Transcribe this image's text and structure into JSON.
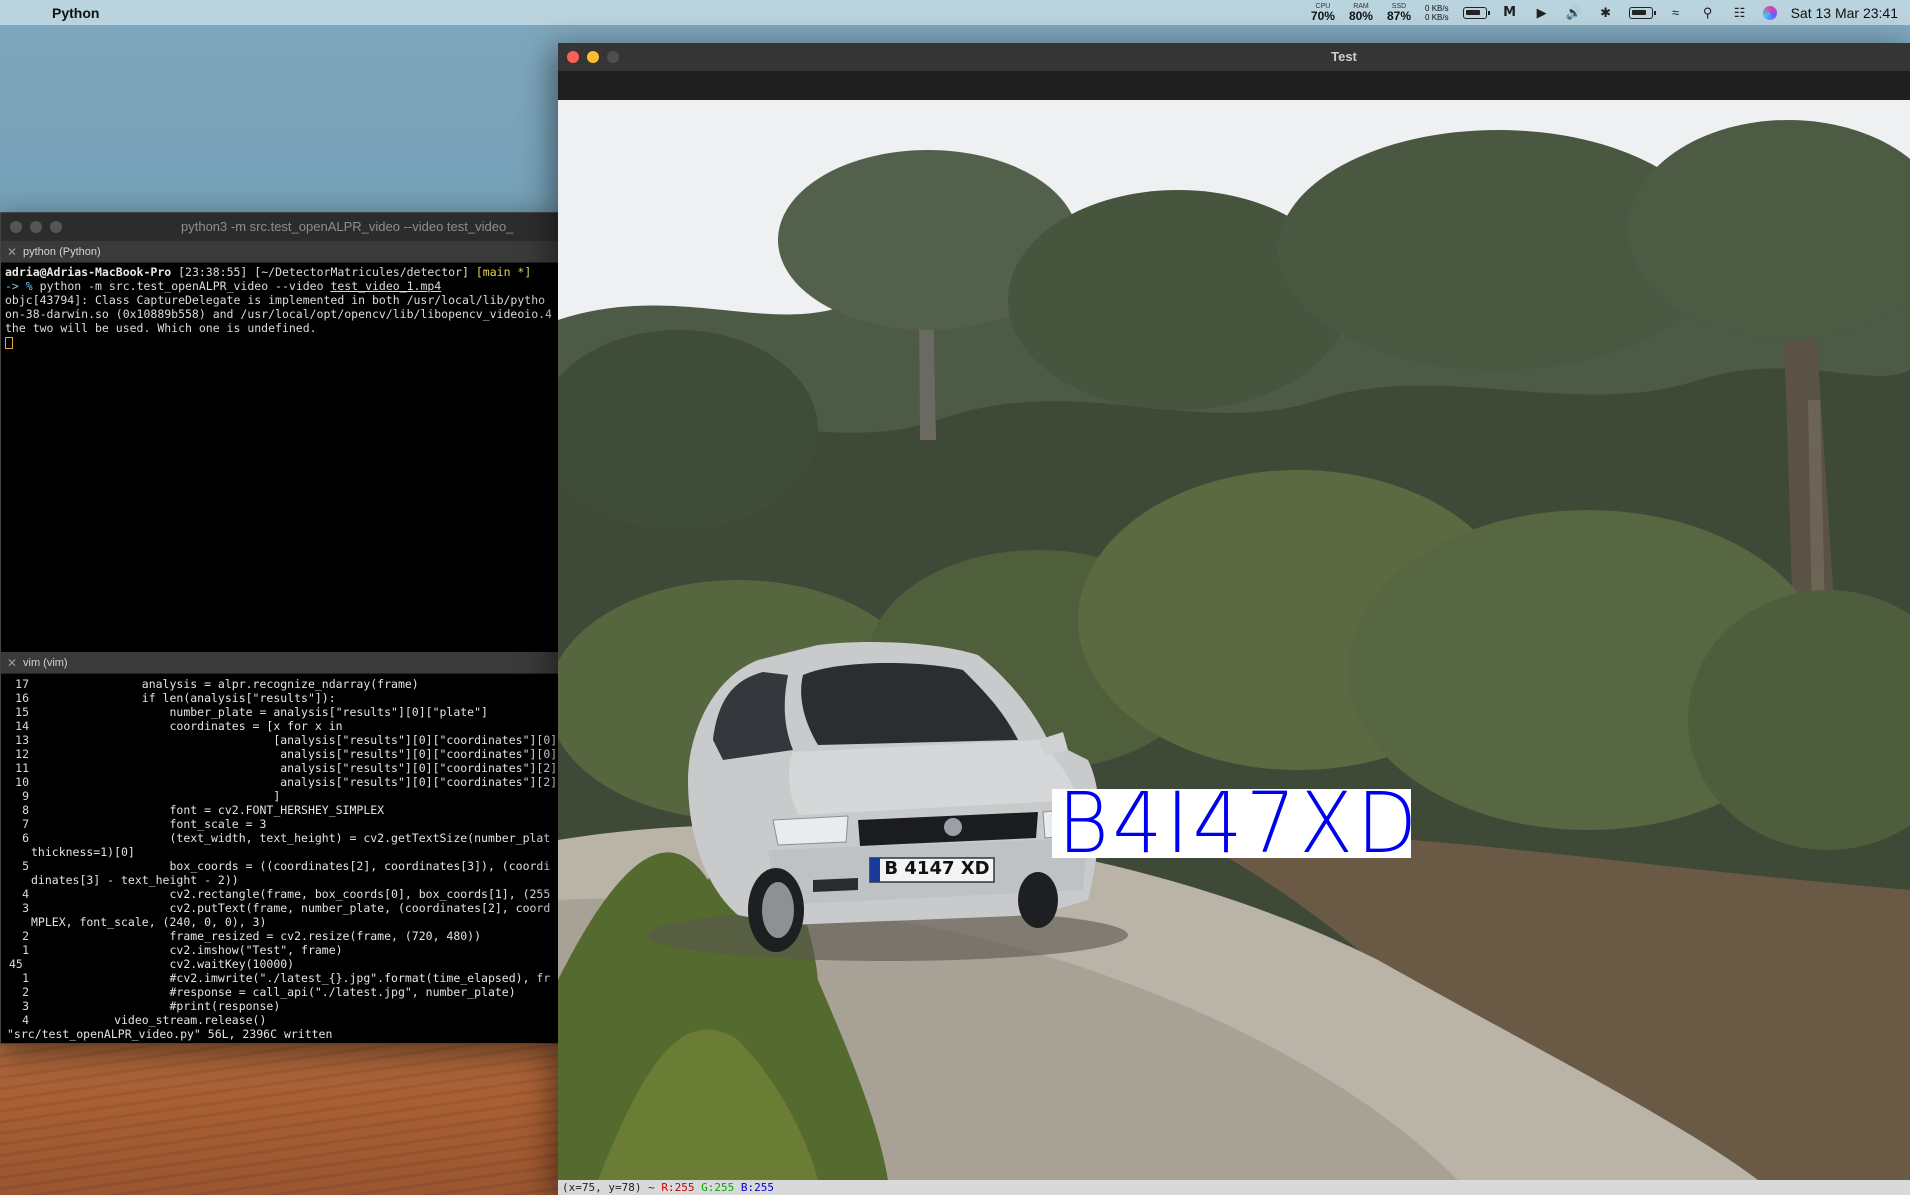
{
  "menubar": {
    "app_name": "Python",
    "cpu_label": "CPU",
    "cpu_value": "70%",
    "ram_label": "RAM",
    "ram_value": "80%",
    "ssd_label": "SSD",
    "ssd_value": "87%",
    "net_up": "0 KB/s",
    "net_down": "0 KB/s",
    "clock": "Sat 13 Mar  23:41"
  },
  "terminal": {
    "title": "python3 -m src.test_openALPR_video --video test_video_",
    "pane1_tab": "python (Python)",
    "prompt_user": "adria@Adrias-MacBook-Pro",
    "prompt_time": "[23:38:55]",
    "prompt_dir": "[~/DetectorMatricules/detector]",
    "prompt_branch": "[main *]",
    "prompt_arrow": "-> %",
    "command": "python -m src.test_openALPR_video --video",
    "command_arg": "test_video_1.mp4",
    "output": [
      "objc[43794]: Class CaptureDelegate is implemented in both /usr/local/lib/pytho",
      "on-38-darwin.so (0x10889b558) and /usr/local/opt/opencv/lib/libopencv_videoio.4",
      "the two will be used. Which one is undefined."
    ],
    "vim_tab": "vim (vim)",
    "vim_lines": [
      {
        "n": "17",
        "code": "                analysis = alpr.recognize_ndarray(frame)"
      },
      {
        "n": "16",
        "code": "                if len(analysis[\"results\"]):"
      },
      {
        "n": "15",
        "code": "                    number_plate = analysis[\"results\"][0][\"plate\"]"
      },
      {
        "n": "14",
        "code": "                    coordinates = [x for x in"
      },
      {
        "n": "13",
        "code": "                                   [analysis[\"results\"][0][\"coordinates\"][0]"
      },
      {
        "n": "12",
        "code": "                                    analysis[\"results\"][0][\"coordinates\"][0]"
      },
      {
        "n": "11",
        "code": "                                    analysis[\"results\"][0][\"coordinates\"][2]"
      },
      {
        "n": "10",
        "code": "                                    analysis[\"results\"][0][\"coordinates\"][2]"
      },
      {
        "n": "9",
        "code": "                                   ]"
      },
      {
        "n": "8",
        "code": "                    font = cv2.FONT_HERSHEY_SIMPLEX"
      },
      {
        "n": "7",
        "code": "                    font_scale = 3"
      },
      {
        "n": "6",
        "code": "                    (text_width, text_height) = cv2.getTextSize(number_plat"
      },
      {
        "n": "",
        "code": "thickness=1)[0]"
      },
      {
        "n": "5",
        "code": "                    box_coords = ((coordinates[2], coordinates[3]), (coordi"
      },
      {
        "n": "",
        "code": "dinates[3] - text_height - 2))"
      },
      {
        "n": "4",
        "code": "                    cv2.rectangle(frame, box_coords[0], box_coords[1], (255"
      },
      {
        "n": "3",
        "code": "                    cv2.putText(frame, number_plate, (coordinates[2], coord"
      },
      {
        "n": "",
        "code": "MPLEX, font_scale, (240, 0, 0), 3)"
      },
      {
        "n": "2",
        "code": "                    frame_resized = cv2.resize(frame, (720, 480))"
      },
      {
        "n": "1",
        "code": "                    cv2.imshow(\"Test\", frame)"
      },
      {
        "n": "45",
        "code": "                    cv2.waitKey(10000)",
        "current": true
      },
      {
        "n": "1",
        "code": "                    #cv2.imwrite(\"./latest_{}.jpg\".format(time_elapsed), fr"
      },
      {
        "n": "2",
        "code": "                    #response = call_api(\"./latest.jpg\", number_plate)"
      },
      {
        "n": "3",
        "code": "                    #print(response)"
      },
      {
        "n": "4",
        "code": "            video_stream.release()"
      }
    ],
    "vim_status": "\"src/test_openALPR_video.py\" 56L, 2396C written"
  },
  "cv_window": {
    "title": "Test",
    "plate_overlay": "B4I47XD",
    "car_plate": "B 4147 XD",
    "status_prefix": "(x=75, y=78) ~",
    "status_r": "R:255",
    "status_g": "G:255",
    "status_b": "B:255"
  },
  "colors": {
    "overlay_text": "#0000f0",
    "menubar_bg": "#b9d3df"
  }
}
